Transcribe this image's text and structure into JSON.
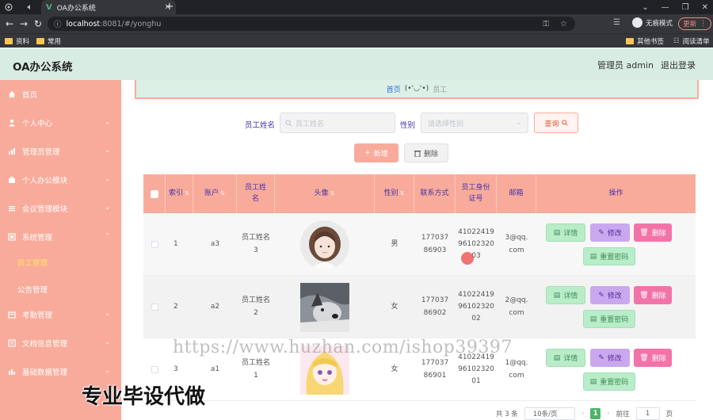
{
  "browser": {
    "tab_title": "OA办公系统",
    "url_host": "localhost",
    "url_path": ":8081/#/yonghu",
    "incognito_label": "无痕模式",
    "update_label": "更新",
    "bookmarks": [
      "资料",
      "常用"
    ],
    "bookmarks_right": [
      "其他书签",
      "阅读清单"
    ]
  },
  "header": {
    "title": "OA办公系统",
    "admin": "管理员 admin",
    "logout": "退出登录"
  },
  "sidebar": {
    "items": [
      {
        "label": "首页",
        "icon": "home-icon"
      },
      {
        "label": "个人中心",
        "icon": "user-icon"
      },
      {
        "label": "管理员管理",
        "icon": "chart-icon"
      },
      {
        "label": "个人办公模块",
        "icon": "briefcase-icon"
      },
      {
        "label": "会议管理模块",
        "icon": "list-icon"
      },
      {
        "label": "系统管理",
        "icon": "system-icon"
      },
      {
        "label": "考勤管理",
        "icon": "clock-icon"
      },
      {
        "label": "文档信息管理",
        "icon": "document-icon"
      },
      {
        "label": "基础数据管理",
        "icon": "bar-chart-icon"
      }
    ],
    "sub_items": [
      "员工管理",
      "公告管理"
    ]
  },
  "breadcrumb": {
    "home": "首页",
    "emoji": "(•'◡'•)",
    "current": "员工"
  },
  "search": {
    "name_label": "员工姓名",
    "name_placeholder": "员工姓名",
    "gender_label": "性别",
    "gender_placeholder": "请选择性别",
    "query_label": "查询"
  },
  "actions": {
    "add_label": "新增",
    "delete_label": "删除"
  },
  "table": {
    "headers": [
      "索引",
      "账户",
      "员工姓名",
      "头像",
      "性别",
      "联系方式",
      "员工身份证号",
      "邮箱",
      "操作"
    ],
    "rows": [
      {
        "index": "1",
        "account": "a3",
        "name": "员工姓名3",
        "gender": "男",
        "phone": "17703786903",
        "id_card": "410224199610232003",
        "email": "3@qq.com"
      },
      {
        "index": "2",
        "account": "a2",
        "name": "员工姓名2",
        "gender": "女",
        "phone": "17703786902",
        "id_card": "410224199610232002",
        "email": "2@qq.com"
      },
      {
        "index": "3",
        "account": "a1",
        "name": "员工姓名1",
        "gender": "女",
        "phone": "17703786901",
        "id_card": "410224199610232001",
        "email": "1@qq.com"
      }
    ],
    "row_actions": {
      "detail": "详情",
      "edit": "修改",
      "delete": "删除",
      "reset": "重置密码"
    }
  },
  "pagination": {
    "total": "共 3 条",
    "page_size": "10条/页",
    "current": "1",
    "goto_label": "前往",
    "goto_value": "1",
    "page_suffix": "页"
  },
  "watermark": {
    "url": "https://www.huzhan.com/ishop39397",
    "text": "专业毕设代做"
  }
}
